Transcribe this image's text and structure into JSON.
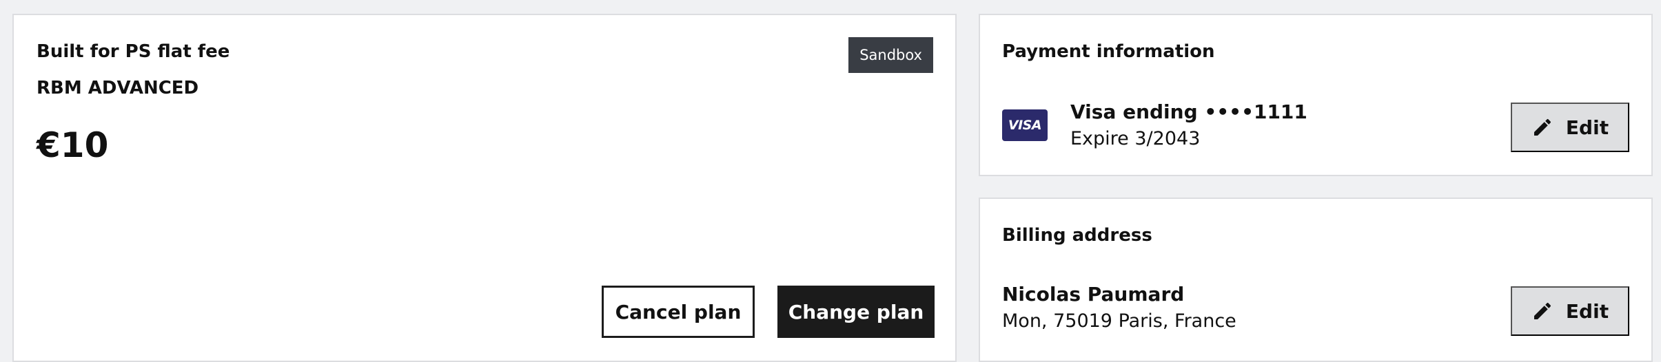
{
  "plan": {
    "name": "Built for PS flat fee",
    "tier": "RBM ADVANCED",
    "price": "€10",
    "badge": "Sandbox",
    "cancel_label": "Cancel plan",
    "change_label": "Change plan"
  },
  "payment": {
    "title": "Payment information",
    "card_brand": "VISA",
    "card_line": "Visa ending ••••1111",
    "expiry": "Expire 3/2043",
    "edit_label": "Edit",
    "edit_icon": "pencil-icon"
  },
  "billing": {
    "title": "Billing address",
    "name": "Nicolas Paumard",
    "address": "Mon, 75019 Paris, France",
    "edit_label": "Edit",
    "edit_icon": "pencil-icon"
  },
  "colors": {
    "page_bg": "#f0f1f3",
    "badge_bg": "#393d44",
    "primary_button": "#1b1b1b",
    "edit_button": "#dedfe1",
    "visa_bg": "#2b2a6b"
  }
}
